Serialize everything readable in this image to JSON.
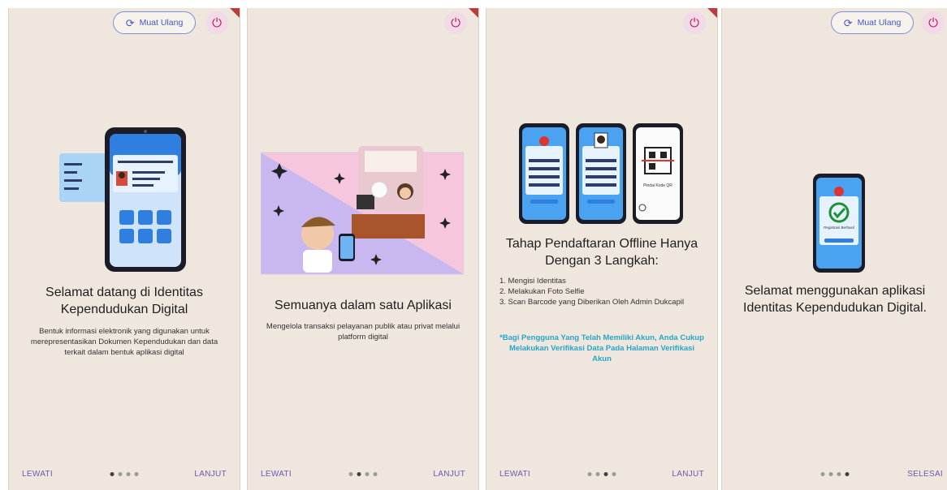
{
  "common": {
    "reload_label": "Muat Ulang",
    "skip_label": "LEWATI",
    "next_label": "LANJUT",
    "finish_label": "SELESAI",
    "reload_icon": "refresh-icon",
    "power_icon": "power-icon"
  },
  "colors": {
    "background": "#efe7dd",
    "accent": "#6b57b5",
    "note": "#26a6c9",
    "power": "#c2185b"
  },
  "screen1": {
    "title": "Selamat datang di Identitas Kependudukan Digital",
    "description": "Bentuk informasi elektronik yang digunakan untuk merepresentasikan Dokumen Kependudukan dan data terkait dalam bentuk aplikasi digital",
    "active_page": 1
  },
  "screen2": {
    "title": "Semuanya dalam satu Aplikasi",
    "description": "Mengelola transaksi pelayanan publik atau privat melalui platform digital",
    "active_page": 2
  },
  "screen3": {
    "title": "Tahap Pendaftaran Offline Hanya Dengan 3 Langkah:",
    "steps": [
      "1. Mengisi Identitas",
      "2. Melakukan Foto Selfie",
      "3. Scan Barcode yang Diberikan Oleh Admin Dukcapil"
    ],
    "note": "*Bagi Pengguna Yang Telah Memiliki Akun, Anda Cukup Melakukan Verifikasi Data Pada Halaman Verifikasi Akun",
    "qr_caption": "Pindai Kode QR",
    "active_page": 3
  },
  "screen4": {
    "title": "Selamat menggunakan aplikasi Identitas Kependudukan Digital.",
    "success_caption": "Registrasi Berhasil",
    "active_page": 4
  }
}
